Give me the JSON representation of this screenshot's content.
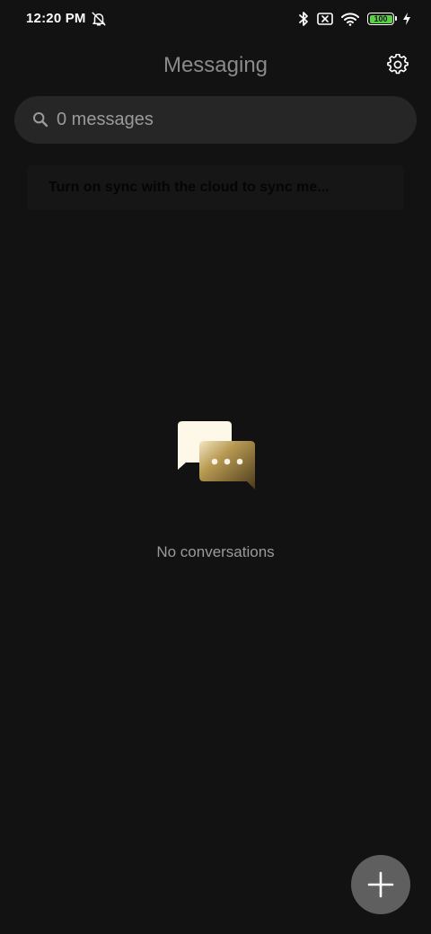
{
  "status_bar": {
    "time": "12:20 PM",
    "battery_level": "100",
    "battery_color": "#57d43b",
    "icons": [
      "alarm-off-icon",
      "bluetooth-icon",
      "no-sim-icon",
      "wifi-icon",
      "battery-icon",
      "charging-icon"
    ]
  },
  "header": {
    "title": "Messaging",
    "settings_icon": "gear-icon"
  },
  "search": {
    "placeholder": "0 messages",
    "icon": "search-icon"
  },
  "sync_banner": {
    "text": "Turn on sync with the cloud to sync me..."
  },
  "empty_state": {
    "text": "No conversations",
    "icon": "chat-bubbles-icon"
  },
  "fab": {
    "icon": "plus-icon"
  }
}
